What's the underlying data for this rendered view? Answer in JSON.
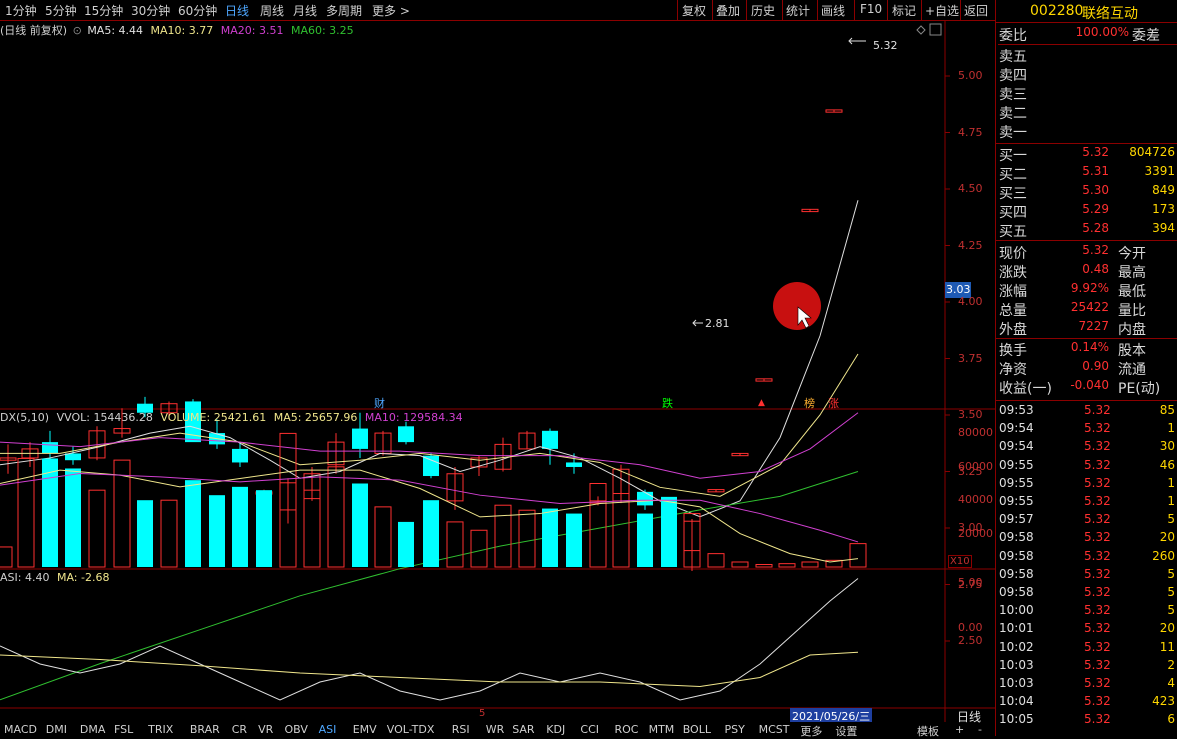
{
  "topbar": {
    "periods": [
      "1分钟",
      "5分钟",
      "15分钟",
      "30分钟",
      "60分钟",
      "日线",
      "周线",
      "月线",
      "多周期",
      "更多 >"
    ],
    "active_period": "日线",
    "tools": [
      "复权",
      "叠加",
      "历史",
      "统计",
      "画线",
      "F10",
      "标记",
      "+自选",
      "返回"
    ]
  },
  "main": {
    "title": "(日线 前复权)",
    "ma5": "MA5: 4.44",
    "ma10": "MA10: 3.77",
    "ma20": "MA20: 3.51",
    "ma60": "MA60: 3.25",
    "y_ticks": [
      "5.00",
      "4.75",
      "4.50",
      "4.25",
      "4.00",
      "3.75",
      "3.50",
      "3.25",
      "3.00",
      "2.75",
      "2.50"
    ],
    "high_label": "5.32",
    "low_label": "2.81",
    "current_price_tag": "3.03",
    "event_labels": [
      "财",
      "跌",
      "榜",
      "涨"
    ],
    "colors": {
      "up": "#ff3030",
      "down": "#00ffff",
      "ma5": "#e0e0e0",
      "ma10": "#f0e68c",
      "ma20": "#d040d0",
      "ma60": "#30c030"
    }
  },
  "volume": {
    "title": "DX(5,10)",
    "vvol": "VVOL: 154436.28",
    "volume": "VOLUME: 25421.61",
    "ma5": "MA5: 25657.96",
    "ma10": "MA10: 129584.34",
    "y_ticks": [
      "80000",
      "60000",
      "40000",
      "20000"
    ],
    "unit": "X10"
  },
  "asi": {
    "title": "ASI: 4.40",
    "ma": "MA: -2.68",
    "y_ticks": [
      "5.00",
      "0.00"
    ]
  },
  "date_label": "2021/05/26/三",
  "period_tag": "日线",
  "bottom_tabs": [
    "MACD",
    "DMI",
    "DMA",
    "FSL",
    "TRIX",
    "BRAR",
    "CR",
    "VR",
    "OBV",
    "ASI",
    "EMV",
    "VOL-TDX",
    "RSI",
    "WR",
    "SAR",
    "KDJ",
    "CCI",
    "ROC",
    "MTM",
    "BOLL",
    "PSY",
    "MCST",
    "更多",
    "设置"
  ],
  "active_tab": "ASI",
  "bottom_right": [
    "模板",
    "+",
    "-"
  ],
  "stock": {
    "code": "002280",
    "name": "联络互动"
  },
  "order_book": {
    "weibi_label": "委比",
    "weibi_value": "100.00%",
    "weicha_label": "委差",
    "sells": [
      "卖五",
      "卖四",
      "卖三",
      "卖二",
      "卖一"
    ],
    "buys": [
      {
        "label": "买一",
        "price": "5.32",
        "vol": "804726"
      },
      {
        "label": "买二",
        "price": "5.31",
        "vol": "3391"
      },
      {
        "label": "买三",
        "price": "5.30",
        "vol": "849"
      },
      {
        "label": "买四",
        "price": "5.29",
        "vol": "173"
      },
      {
        "label": "买五",
        "price": "5.28",
        "vol": "394"
      }
    ]
  },
  "quote": [
    {
      "k": "现价",
      "v": "5.32",
      "k2": "今开"
    },
    {
      "k": "涨跌",
      "v": "0.48",
      "k2": "最高"
    },
    {
      "k": "涨幅",
      "v": "9.92%",
      "k2": "最低"
    },
    {
      "k": "总量",
      "v": "25422",
      "k2": "量比"
    },
    {
      "k": "外盘",
      "v": "7227",
      "k2": "内盘"
    },
    {
      "k": "换手",
      "v": "0.14%",
      "k2": "股本"
    },
    {
      "k": "净资",
      "v": "0.90",
      "k2": "流通"
    },
    {
      "k": "收益(一)",
      "v": "-0.040",
      "k2": "PE(动)"
    }
  ],
  "ticks": [
    {
      "t": "09:53",
      "p": "5.32",
      "v": "85"
    },
    {
      "t": "09:54",
      "p": "5.32",
      "v": "1"
    },
    {
      "t": "09:54",
      "p": "5.32",
      "v": "30"
    },
    {
      "t": "09:55",
      "p": "5.32",
      "v": "46"
    },
    {
      "t": "09:55",
      "p": "5.32",
      "v": "1"
    },
    {
      "t": "09:55",
      "p": "5.32",
      "v": "1"
    },
    {
      "t": "09:57",
      "p": "5.32",
      "v": "5"
    },
    {
      "t": "09:58",
      "p": "5.32",
      "v": "20"
    },
    {
      "t": "09:58",
      "p": "5.32",
      "v": "260"
    },
    {
      "t": "09:58",
      "p": "5.32",
      "v": "5"
    },
    {
      "t": "09:58",
      "p": "5.32",
      "v": "5"
    },
    {
      "t": "10:00",
      "p": "5.32",
      "v": "5"
    },
    {
      "t": "10:01",
      "p": "5.32",
      "v": "20"
    },
    {
      "t": "10:02",
      "p": "5.32",
      "v": "11"
    },
    {
      "t": "10:03",
      "p": "5.32",
      "v": "2"
    },
    {
      "t": "10:03",
      "p": "5.32",
      "v": "4"
    },
    {
      "t": "10:04",
      "p": "5.32",
      "v": "423"
    },
    {
      "t": "10:05",
      "p": "5.32",
      "v": "6"
    }
  ]
}
